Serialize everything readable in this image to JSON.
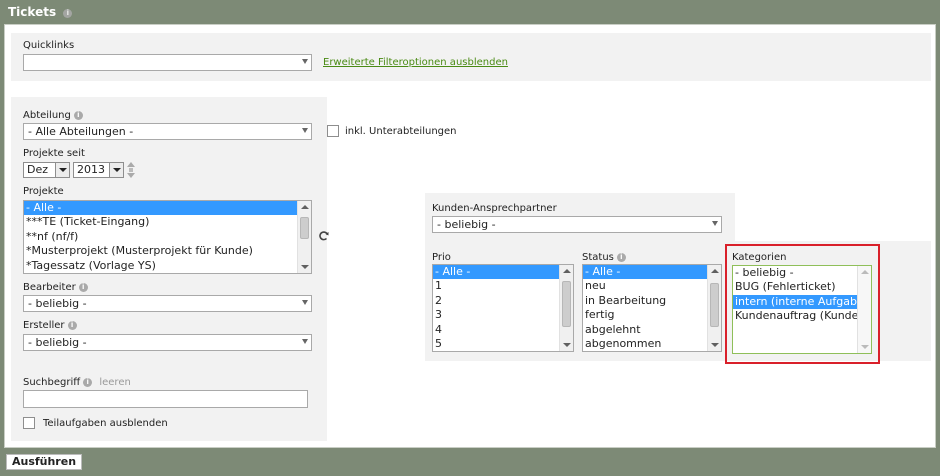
{
  "window": {
    "title": "Tickets"
  },
  "quicklinks": {
    "label": "Quicklinks",
    "value": "",
    "toggle_link": "Erweiterte Filteroptionen ausblenden"
  },
  "abteilung": {
    "label": "Abteilung",
    "value": "- Alle Abteilungen -",
    "sub_checkbox_label": "inkl. Unterabteilungen"
  },
  "projekte_seit": {
    "label": "Projekte seit",
    "month": "Dez",
    "year": "2013"
  },
  "projekte": {
    "label": "Projekte",
    "items": [
      "- Alle -",
      "***TE (Ticket-Eingang)",
      "**nf (nf/f)",
      "*Musterprojekt (Musterprojekt für Kunde)",
      "*Tagessatz (Vorlage YS)"
    ],
    "selected_index": 0
  },
  "bearbeiter": {
    "label": "Bearbeiter",
    "value": "- beliebig -"
  },
  "ersteller": {
    "label": "Ersteller",
    "value": "- beliebig -"
  },
  "suchbegriff": {
    "label": "Suchbegriff",
    "clear_link": "leeren",
    "value": ""
  },
  "teilaufgaben": {
    "label": "Teilaufgaben ausblenden"
  },
  "kunden_ansprechpartner": {
    "label": "Kunden-Ansprechpartner",
    "value": "- beliebig -"
  },
  "prio": {
    "label": "Prio",
    "items": [
      "- Alle -",
      "1",
      "2",
      "3",
      "4",
      "5"
    ],
    "selected_index": 0
  },
  "status": {
    "label": "Status",
    "items": [
      "- Alle -",
      "neu",
      "in Bearbeitung",
      "fertig",
      "abgelehnt",
      "abgenommen"
    ],
    "selected_index": 0
  },
  "kategorien": {
    "label": "Kategorien",
    "items": [
      "- beliebig -",
      "BUG (Fehlerticket)",
      "intern (interne Aufgaben)",
      "Kundenauftrag (Kunde)"
    ],
    "selected_index": 2
  },
  "actions": {
    "run_label": "Ausführen"
  },
  "colors": {
    "accent": "#7d8a76",
    "selection": "#3399ff",
    "highlight": "#d9202a",
    "link": "#4a8b14"
  }
}
